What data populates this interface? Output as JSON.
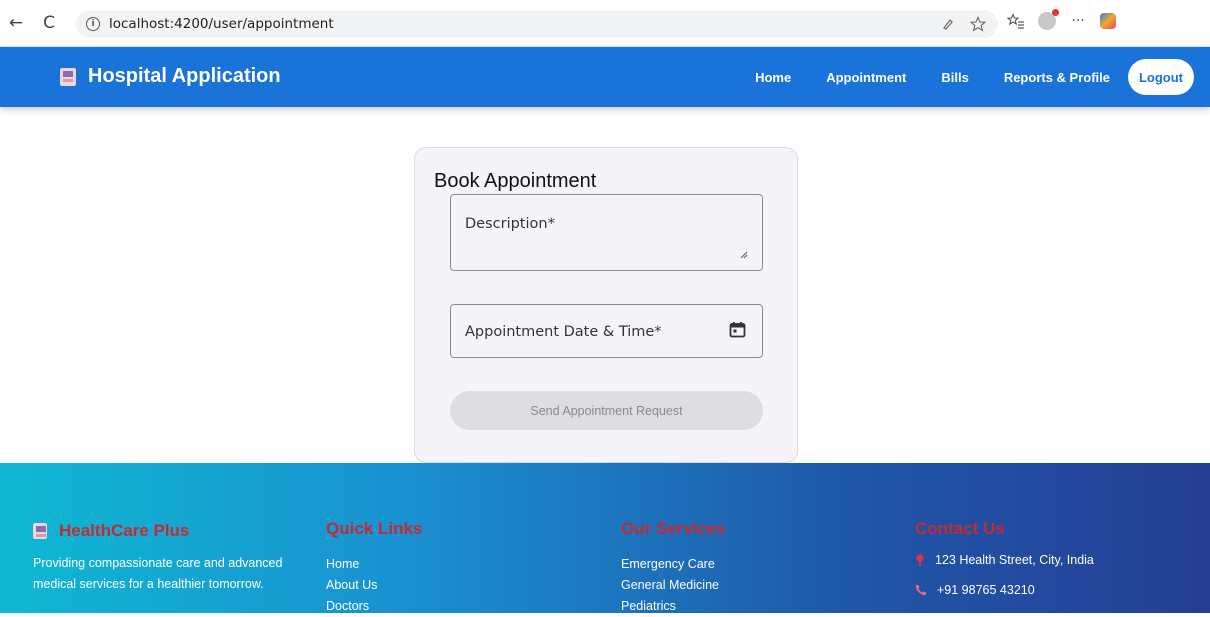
{
  "browser": {
    "url": "localhost:4200/user/appointment",
    "back_glyph": "←",
    "reload_glyph": "C",
    "info_glyph": "i",
    "more_glyph": "···",
    "icons": [
      "back-arrow-icon",
      "reload-icon",
      "info-icon",
      "read-aloud-icon",
      "favorite-star-icon",
      "favorites-list-icon",
      "profile-avatar-icon",
      "more-options-icon",
      "copilot-icon"
    ]
  },
  "header": {
    "title": "Hospital Application",
    "nav": [
      "Home",
      "Appointment",
      "Bills",
      "Reports & Profile"
    ],
    "logout_label": "Logout",
    "colors": {
      "bar": "#1a73d8",
      "logout_bg": "#ffffff"
    }
  },
  "form": {
    "title": "Book Appointment",
    "description_label": "Description*",
    "date_label": "Appointment Date & Time*",
    "submit_label": "Send Appointment Request",
    "submit_disabled": true
  },
  "footer": {
    "brand": "HealthCare Plus",
    "tagline": "Providing compassionate care and advanced medical services for a healthier tomorrow.",
    "quick_links_heading": "Quick Links",
    "quick_links": [
      "Home",
      "About Us",
      "Doctors"
    ],
    "services_heading": "Our Services",
    "services": [
      "Emergency Care",
      "General Medicine",
      "Pediatrics"
    ],
    "contact_heading": "Contact Us",
    "address": "123 Health Street, City, India",
    "phone": "+91 98765 43210",
    "colors": {
      "heading": "#c22b33",
      "gradient_start": "#0fb8d2",
      "gradient_end": "#253e96"
    }
  }
}
